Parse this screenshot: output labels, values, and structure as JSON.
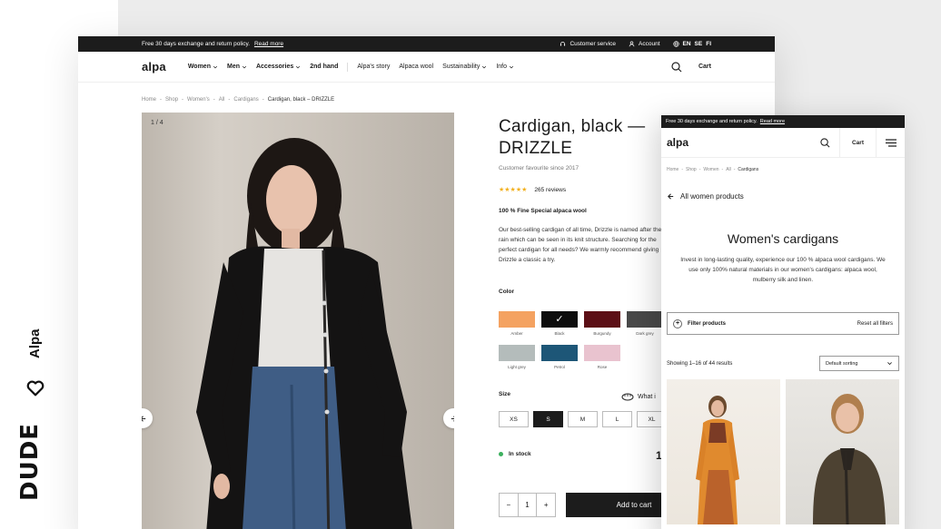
{
  "branding": {
    "agency": "DUDE",
    "client": "Alpa"
  },
  "desktop": {
    "topbar": {
      "promo": "Free 30 days exchange and return policy.",
      "promo_link": "Read more",
      "customer_service": "Customer service",
      "account": "Account",
      "languages": [
        "EN",
        "SE",
        "FI"
      ]
    },
    "nav": {
      "logo": "alpa",
      "menu": [
        "Women",
        "Men",
        "Accessories",
        "2nd hand",
        "Alpa's story",
        "Alpaca wool",
        "Sustainability",
        "Info"
      ],
      "cart": "Cart"
    },
    "breadcrumbs": [
      "Home",
      "Shop",
      "Women's",
      "All",
      "Cardigans",
      "Cardigan, black – DRIZZLE"
    ],
    "gallery": {
      "counter": "1 / 4"
    },
    "product": {
      "title": "Cardigan, black — DRIZZLE",
      "subtitle": "Customer favourite since 2017",
      "stars": "★★★★★",
      "reviews": "265 reviews",
      "material": "100 % Fine Special alpaca wool",
      "description": "Our best-selling cardigan of all time, Drizzle is named after the rain which can be seen in its knit structure. Searching for the perfect cardigan for all needs? We warmly recommend giving Drizzle a classic a try.",
      "color_label": "Color",
      "colors": [
        {
          "name": "Amber",
          "hex": "#f4a261",
          "selected": false
        },
        {
          "name": "Black",
          "hex": "#0d0d0d",
          "selected": true
        },
        {
          "name": "Burgundy",
          "hex": "#5c0f16",
          "selected": false
        },
        {
          "name": "Dark grey",
          "hex": "#494949",
          "selected": false
        },
        {
          "name": "Light grey",
          "hex": "#b4bcbb",
          "selected": false
        },
        {
          "name": "Petrol",
          "hex": "#1d5677",
          "selected": false
        },
        {
          "name": "Rose",
          "hex": "#e9c3cf",
          "selected": false
        }
      ],
      "size_label": "Size",
      "size_guide": "What i",
      "sizes": [
        "XS",
        "S",
        "M",
        "L",
        "XL"
      ],
      "selected_size": "S",
      "stock": "In stock",
      "price": "1",
      "quantity": "1",
      "add_to_cart": "Add to cart"
    }
  },
  "mobile": {
    "topbar": {
      "promo": "Free 30 days exchange and return policy.",
      "promo_link": "Read more"
    },
    "nav": {
      "logo": "alpa",
      "cart": "Cart"
    },
    "breadcrumbs": [
      "Home",
      "Shop",
      "Women",
      "All",
      "Cardigans"
    ],
    "back_link": "All women products",
    "title": "Women's cardigans",
    "description": "Invest in long-lasting quality, experience our 100 % alpaca wool cardigans. We use only 100% natural materials in our women's cardigans: alpaca wool, mulberry silk and linen.",
    "filter": "Filter products",
    "reset": "Reset all filters",
    "results": "Showing 1–16 of 44 results",
    "sort": "Default sorting"
  }
}
